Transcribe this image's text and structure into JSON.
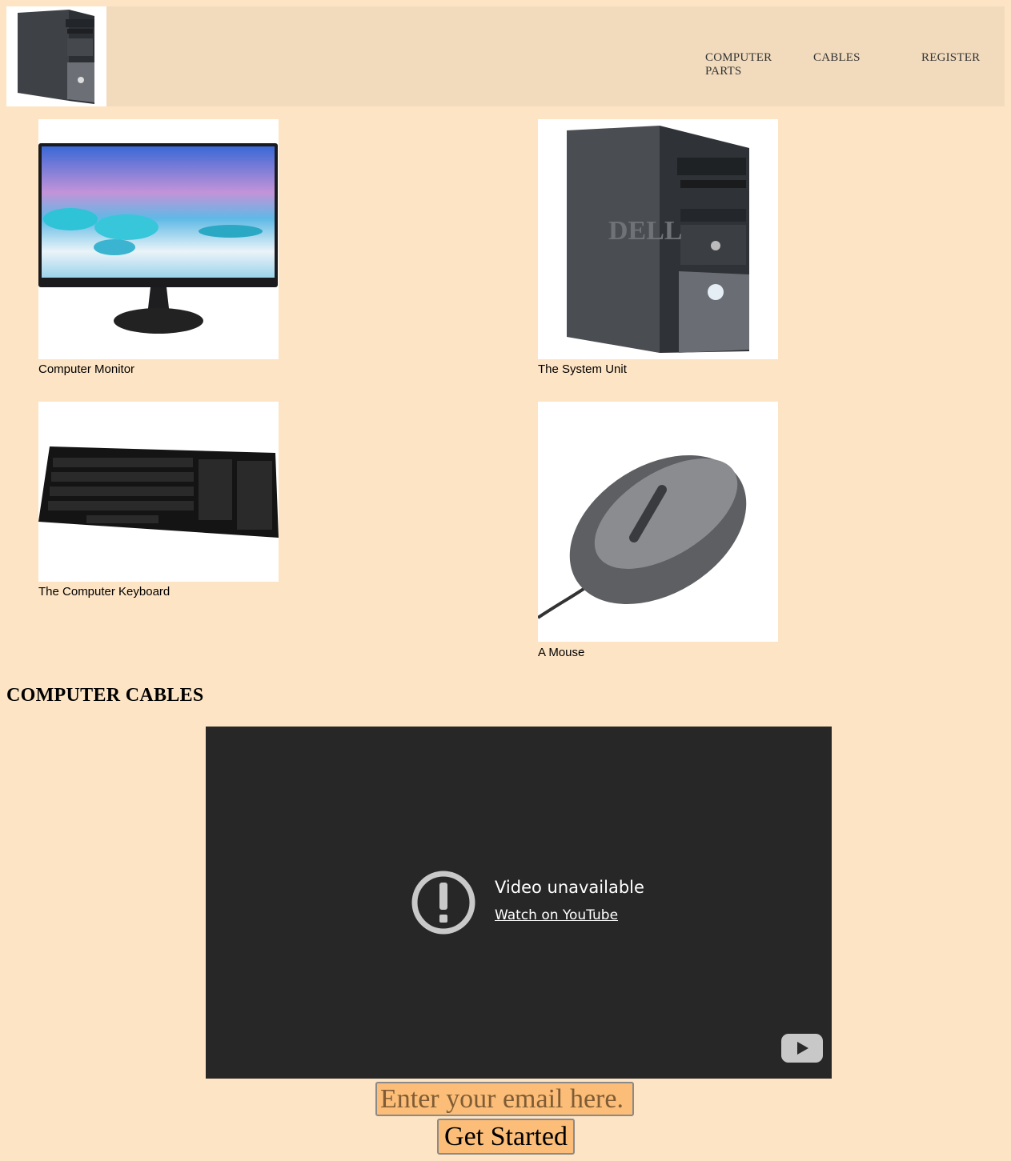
{
  "nav": {
    "items": [
      {
        "line1": "COMPUTER",
        "line2": "PARTS"
      },
      {
        "line1": "CABLES",
        "line2": ""
      },
      {
        "line1": "REGISTER",
        "line2": ""
      }
    ]
  },
  "products": [
    {
      "caption": "Computer Monitor"
    },
    {
      "caption": "The System Unit"
    },
    {
      "caption": "The Computer Keyboard"
    },
    {
      "caption": "A Mouse"
    }
  ],
  "section": {
    "title": "COMPUTER CABLES"
  },
  "video": {
    "message": "Video unavailable",
    "link": "Watch on YouTube"
  },
  "signup": {
    "placeholder": "Enter your email here.",
    "button": "Get Started"
  },
  "colors": {
    "page_bg": "#fde4c4",
    "header_bg": "#f2dbbd",
    "button_bg": "#fbbd77",
    "video_bg": "#272727"
  }
}
